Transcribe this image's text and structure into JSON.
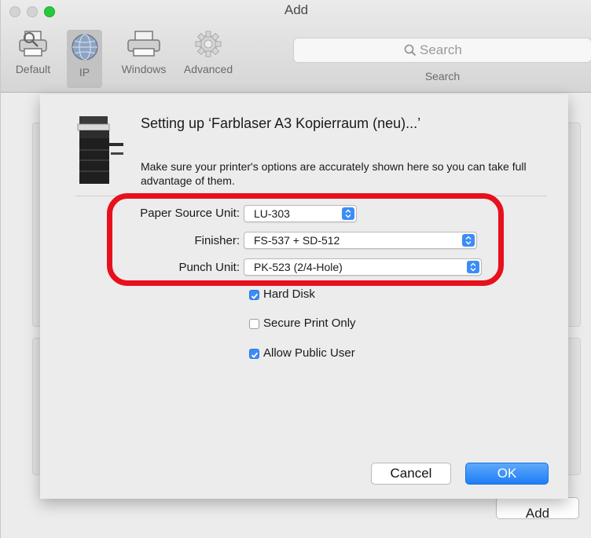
{
  "window": {
    "title": "Add"
  },
  "toolbar": {
    "items": [
      {
        "label": "Default",
        "icon": "default-printer-icon"
      },
      {
        "label": "IP",
        "icon": "globe-icon",
        "selected": true
      },
      {
        "label": "Windows",
        "icon": "windows-printer-icon"
      },
      {
        "label": "Advanced",
        "icon": "gear-icon"
      }
    ],
    "search": {
      "placeholder": "Search",
      "label": "Search"
    }
  },
  "sheet": {
    "title": "Setting up ‘Farblaser A3 Kopierraum (neu)...’",
    "description": "Make sure your printer's options are accurately shown here so you can take full advantage of them.",
    "options": [
      {
        "label": "Paper Source Unit:",
        "value": "LU-303"
      },
      {
        "label": "Finisher:",
        "value": "FS-537 + SD-512"
      },
      {
        "label": "Punch Unit:",
        "value": "PK-523 (2/4-Hole)"
      }
    ],
    "checkboxes": [
      {
        "label": "Hard Disk",
        "checked": true
      },
      {
        "label": "Secure Print Only",
        "checked": false
      },
      {
        "label": "Allow Public User",
        "checked": true
      }
    ],
    "cancel_label": "Cancel",
    "ok_label": "OK"
  },
  "background": {
    "add_label": "Add"
  },
  "colors": {
    "accent": "#3d8cf6",
    "highlight": "#e8101d"
  }
}
